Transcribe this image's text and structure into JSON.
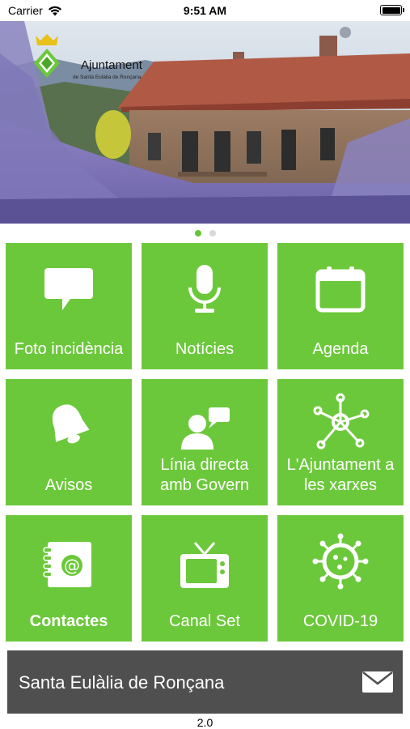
{
  "status_bar": {
    "carrier": "Carrier",
    "time": "9:51 AM"
  },
  "banner": {
    "logo_title": "Ajuntament",
    "logo_subtitle": "de Santa Eulàlia de Ronçana",
    "slide_count": 2,
    "active_slide": 1
  },
  "tiles": [
    {
      "label": "Foto incidència",
      "icon": "chat-bubble-icon"
    },
    {
      "label": "Notícies",
      "icon": "microphone-icon"
    },
    {
      "label": "Agenda",
      "icon": "calendar-icon"
    },
    {
      "label": "Avisos",
      "icon": "bell-icon"
    },
    {
      "label": "Línia directa amb Govern",
      "icon": "person-chat-icon"
    },
    {
      "label": "L'Ajuntament a les xarxes",
      "icon": "network-icon"
    },
    {
      "label": "Contactes",
      "icon": "address-book-icon"
    },
    {
      "label": "Canal Set",
      "icon": "tv-icon"
    },
    {
      "label": "COVID-19",
      "icon": "virus-icon"
    }
  ],
  "footer": {
    "title": "Santa Eulàlia de Ronçana",
    "icon": "mail-icon"
  },
  "version": "2.0",
  "colors": {
    "tile_green": "#6cc83b",
    "footer_gray": "#4f4f4f",
    "active_dot": "#66c33a"
  }
}
